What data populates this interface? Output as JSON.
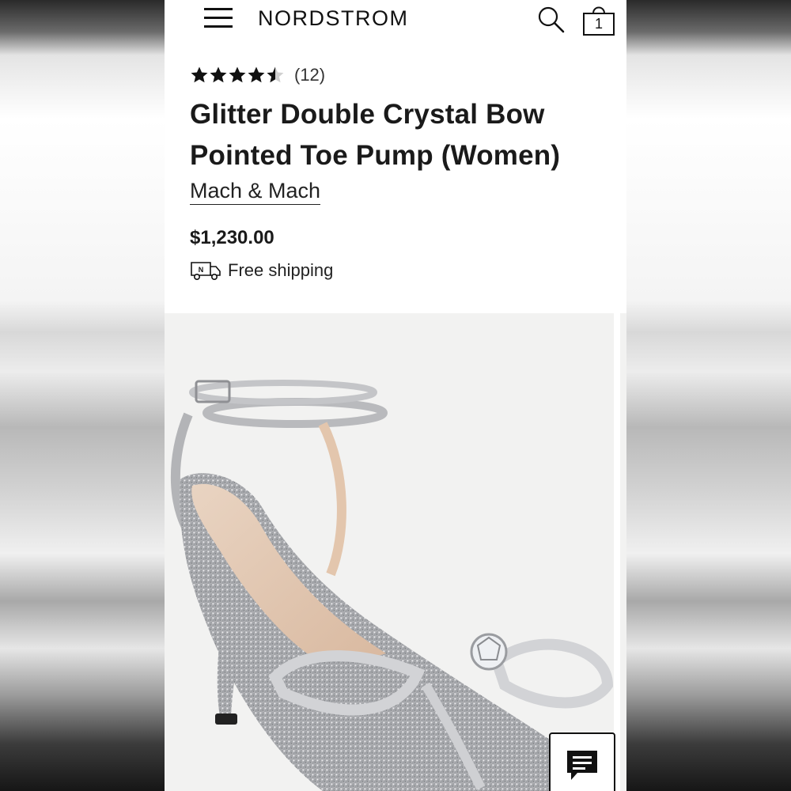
{
  "header": {
    "logo_text": "NORDSTROM",
    "menu_icon": "hamburger-menu-icon",
    "search_icon": "search-icon",
    "bag_icon": "shopping-bag-icon",
    "bag_count": "1"
  },
  "product": {
    "rating": 4.5,
    "review_count": "(12)",
    "title": "Glitter Double Crystal Bow Pointed Toe Pump (Women)",
    "brand": "Mach & Mach",
    "price": "$1,230.00",
    "shipping": {
      "icon": "delivery-truck-icon",
      "label": "Free shipping"
    },
    "image": {
      "subject": "silver glitter pointed toe pump with crystal double bow and ankle strap"
    }
  },
  "chat": {
    "icon": "chat-bubble-icon"
  },
  "colors": {
    "text": "#1a1a1a",
    "background": "#ffffff",
    "image_bg": "#f2f2f1"
  }
}
